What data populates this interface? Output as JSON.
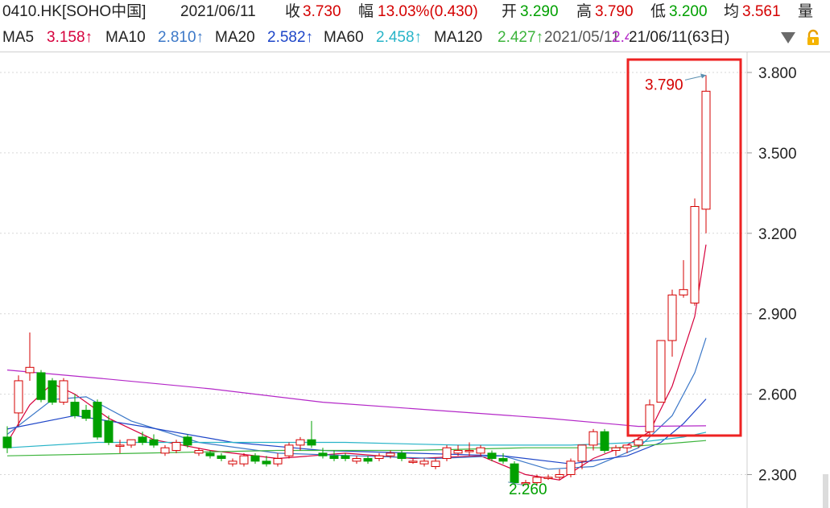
{
  "header": {
    "code": "0410.HK[SOHO中国]",
    "date": "2021/06/11",
    "close_label": "收",
    "close": "3.730",
    "change_label": "幅",
    "change": "13.03%(0.430)",
    "open_label": "开",
    "open": "3.290",
    "high_label": "高",
    "high": "3.790",
    "low_label": "低",
    "low": "3.200",
    "avg_label": "均",
    "avg": "3.561",
    "vol_label": "量"
  },
  "indicators": {
    "ma5_label": "MA5",
    "ma5": "3.158↑",
    "ma10_label": "MA10",
    "ma10": "2.810↑",
    "ma20_label": "MA20",
    "ma20": "2.582↑",
    "ma60_label": "MA60",
    "ma60": "2.458↑",
    "ma120_label": "MA120",
    "ma120": "2.427↑",
    "range_overlap": "2021/05/11",
    "range_overlap2": "2.482",
    "range": "21/06/11(63日)"
  },
  "icons": {
    "dropdown": "chevron-down-icon",
    "lock": "lock-icon"
  },
  "colors": {
    "up": "#d40000",
    "down": "#00a000",
    "ma5": "#d6003c",
    "ma10": "#3c78c8",
    "ma20": "#1e46c8",
    "ma60": "#28b4c8",
    "ma120": "#3cb43c",
    "ma250": "#b428c8",
    "highlight": "#ee2222"
  },
  "chart_data": {
    "type": "candlestick",
    "ylim": [
      2.26,
      3.86
    ],
    "yticks": [
      "3.800",
      "3.500",
      "3.200",
      "2.900",
      "2.600",
      "2.300"
    ],
    "ytick_values": [
      3.8,
      3.5,
      3.2,
      2.9,
      2.6,
      2.3
    ],
    "annotations": [
      {
        "text": "3.790",
        "value": 3.79,
        "kind": "high"
      },
      {
        "text": "2.260",
        "value": 2.26,
        "kind": "low"
      }
    ],
    "candles": [
      [
        2.44,
        2.48,
        2.38,
        2.4
      ],
      [
        2.53,
        2.67,
        2.48,
        2.65
      ],
      [
        2.68,
        2.83,
        2.65,
        2.7
      ],
      [
        2.68,
        2.69,
        2.57,
        2.58
      ],
      [
        2.65,
        2.66,
        2.56,
        2.57
      ],
      [
        2.57,
        2.66,
        2.56,
        2.65
      ],
      [
        2.57,
        2.6,
        2.51,
        2.52
      ],
      [
        2.54,
        2.56,
        2.5,
        2.51
      ],
      [
        2.57,
        2.58,
        2.43,
        2.44
      ],
      [
        2.5,
        2.52,
        2.41,
        2.42
      ],
      [
        2.41,
        2.43,
        2.38,
        2.41
      ],
      [
        2.41,
        2.43,
        2.4,
        2.43
      ],
      [
        2.44,
        2.46,
        2.41,
        2.42
      ],
      [
        2.43,
        2.45,
        2.4,
        2.41
      ],
      [
        2.38,
        2.41,
        2.37,
        2.4
      ],
      [
        2.39,
        2.43,
        2.38,
        2.42
      ],
      [
        2.44,
        2.45,
        2.4,
        2.41
      ],
      [
        2.38,
        2.4,
        2.37,
        2.39
      ],
      [
        2.38,
        2.39,
        2.36,
        2.37
      ],
      [
        2.37,
        2.38,
        2.35,
        2.36
      ],
      [
        2.34,
        2.36,
        2.33,
        2.35
      ],
      [
        2.34,
        2.38,
        2.33,
        2.37
      ],
      [
        2.37,
        2.38,
        2.34,
        2.35
      ],
      [
        2.35,
        2.37,
        2.33,
        2.34
      ],
      [
        2.34,
        2.38,
        2.33,
        2.36
      ],
      [
        2.37,
        2.42,
        2.36,
        2.41
      ],
      [
        2.41,
        2.44,
        2.39,
        2.43
      ],
      [
        2.43,
        2.5,
        2.4,
        2.41
      ],
      [
        2.38,
        2.4,
        2.36,
        2.37
      ],
      [
        2.37,
        2.39,
        2.35,
        2.36
      ],
      [
        2.37,
        2.38,
        2.35,
        2.36
      ],
      [
        2.35,
        2.37,
        2.34,
        2.36
      ],
      [
        2.36,
        2.37,
        2.34,
        2.35
      ],
      [
        2.36,
        2.38,
        2.35,
        2.37
      ],
      [
        2.37,
        2.39,
        2.36,
        2.38
      ],
      [
        2.38,
        2.39,
        2.35,
        2.36
      ],
      [
        2.35,
        2.36,
        2.34,
        2.35
      ],
      [
        2.34,
        2.36,
        2.33,
        2.35
      ],
      [
        2.33,
        2.36,
        2.32,
        2.35
      ],
      [
        2.36,
        2.41,
        2.35,
        2.4
      ],
      [
        2.38,
        2.41,
        2.37,
        2.39
      ],
      [
        2.39,
        2.42,
        2.37,
        2.39
      ],
      [
        2.38,
        2.41,
        2.37,
        2.4
      ],
      [
        2.38,
        2.39,
        2.35,
        2.36
      ],
      [
        2.36,
        2.38,
        2.34,
        2.35
      ],
      [
        2.34,
        2.35,
        2.27,
        2.27
      ],
      [
        2.27,
        2.28,
        2.26,
        2.27
      ],
      [
        2.27,
        2.3,
        2.26,
        2.29
      ],
      [
        2.29,
        2.3,
        2.28,
        2.29
      ],
      [
        2.29,
        2.32,
        2.28,
        2.3
      ],
      [
        2.3,
        2.36,
        2.29,
        2.35
      ],
      [
        2.35,
        2.4,
        2.32,
        2.41
      ],
      [
        2.41,
        2.47,
        2.39,
        2.46
      ],
      [
        2.46,
        2.47,
        2.38,
        2.39
      ],
      [
        2.39,
        2.41,
        2.37,
        2.4
      ],
      [
        2.4,
        2.41,
        2.38,
        2.41
      ],
      [
        2.41,
        2.44,
        2.4,
        2.43
      ],
      [
        2.46,
        2.58,
        2.44,
        2.56
      ],
      [
        2.57,
        2.8,
        2.57,
        2.8
      ],
      [
        2.8,
        2.99,
        2.74,
        2.97
      ],
      [
        2.97,
        3.1,
        2.96,
        2.99
      ],
      [
        2.94,
        3.33,
        2.93,
        3.3
      ],
      [
        3.29,
        3.79,
        3.2,
        3.73
      ]
    ],
    "ma_series": [
      {
        "name": "MA5",
        "color_key": "ma5",
        "points": [
          [
            0,
            2.42
          ],
          [
            2,
            2.56
          ],
          [
            4,
            2.64
          ],
          [
            6,
            2.6
          ],
          [
            9,
            2.51
          ],
          [
            13,
            2.43
          ],
          [
            18,
            2.39
          ],
          [
            24,
            2.36
          ],
          [
            30,
            2.38
          ],
          [
            36,
            2.36
          ],
          [
            42,
            2.37
          ],
          [
            46,
            2.3
          ],
          [
            49,
            2.28
          ],
          [
            52,
            2.36
          ],
          [
            55,
            2.41
          ],
          [
            57,
            2.46
          ],
          [
            59,
            2.63
          ],
          [
            61,
            2.89
          ],
          [
            62,
            3.158
          ]
        ]
      },
      {
        "name": "MA10",
        "color_key": "ma10",
        "points": [
          [
            0,
            2.45
          ],
          [
            4,
            2.58
          ],
          [
            7,
            2.59
          ],
          [
            11,
            2.5
          ],
          [
            17,
            2.42
          ],
          [
            24,
            2.38
          ],
          [
            31,
            2.37
          ],
          [
            38,
            2.36
          ],
          [
            44,
            2.37
          ],
          [
            48,
            2.32
          ],
          [
            52,
            2.33
          ],
          [
            56,
            2.4
          ],
          [
            59,
            2.52
          ],
          [
            61,
            2.68
          ],
          [
            62,
            2.81
          ]
        ]
      },
      {
        "name": "MA20",
        "color_key": "ma20",
        "points": [
          [
            0,
            2.47
          ],
          [
            6,
            2.52
          ],
          [
            12,
            2.48
          ],
          [
            20,
            2.42
          ],
          [
            28,
            2.39
          ],
          [
            36,
            2.38
          ],
          [
            44,
            2.37
          ],
          [
            50,
            2.34
          ],
          [
            55,
            2.37
          ],
          [
            58,
            2.42
          ],
          [
            60,
            2.49
          ],
          [
            62,
            2.582
          ]
        ]
      },
      {
        "name": "MA60",
        "color_key": "ma60",
        "points": [
          [
            0,
            2.4
          ],
          [
            8,
            2.42
          ],
          [
            18,
            2.42
          ],
          [
            30,
            2.42
          ],
          [
            40,
            2.41
          ],
          [
            50,
            2.41
          ],
          [
            56,
            2.42
          ],
          [
            60,
            2.44
          ],
          [
            62,
            2.458
          ]
        ]
      },
      {
        "name": "MA120",
        "color_key": "ma120",
        "points": [
          [
            0,
            2.37
          ],
          [
            12,
            2.38
          ],
          [
            24,
            2.39
          ],
          [
            36,
            2.39
          ],
          [
            46,
            2.4
          ],
          [
            54,
            2.4
          ],
          [
            60,
            2.42
          ],
          [
            62,
            2.427
          ]
        ]
      },
      {
        "name": "MA250",
        "color_key": "ma250",
        "points": [
          [
            0,
            2.69
          ],
          [
            8,
            2.66
          ],
          [
            18,
            2.62
          ],
          [
            28,
            2.57
          ],
          [
            38,
            2.54
          ],
          [
            48,
            2.51
          ],
          [
            56,
            2.48
          ],
          [
            62,
            2.482
          ]
        ]
      }
    ]
  }
}
